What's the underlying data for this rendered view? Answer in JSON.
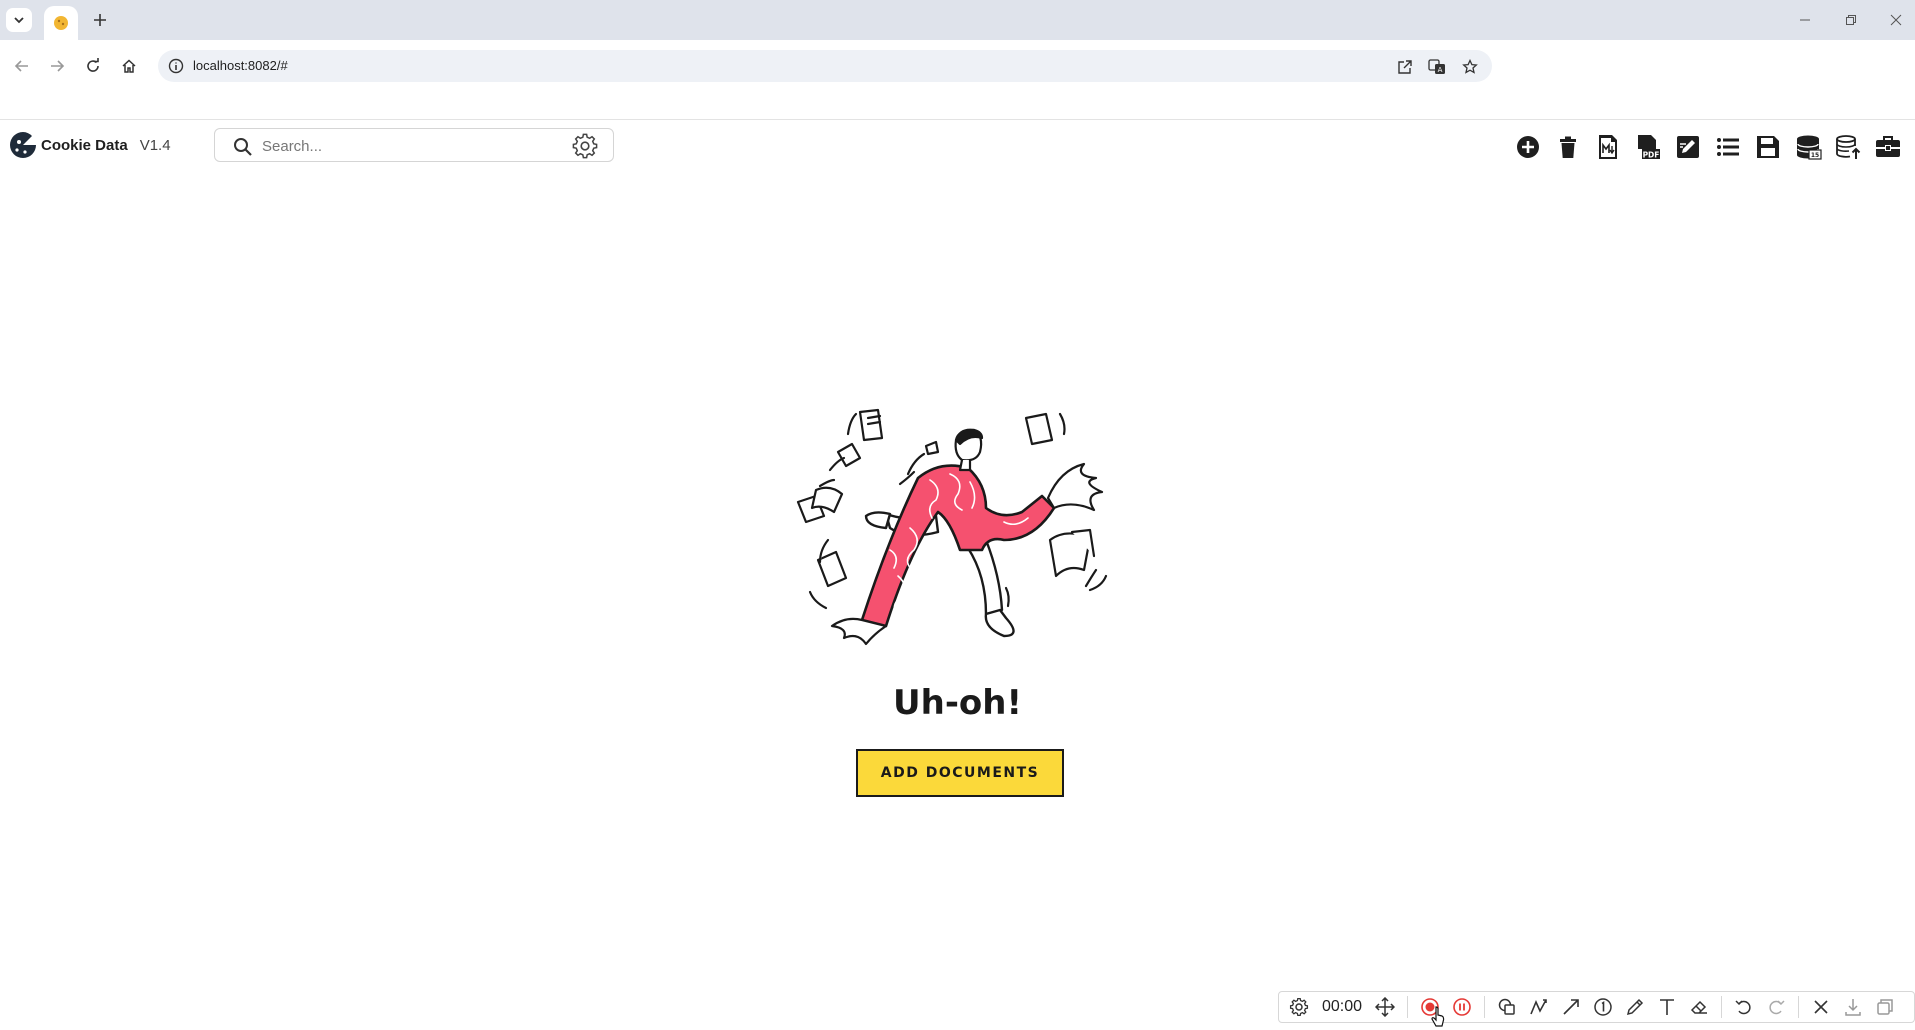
{
  "browser": {
    "url": "localhost:8082/#"
  },
  "app": {
    "brand_name": "Cookie Data",
    "version": "V1.4",
    "search_placeholder": "Search..."
  },
  "toolbar_actions": [
    {
      "name": "add-icon"
    },
    {
      "name": "trash-icon"
    },
    {
      "name": "markdown-file-icon"
    },
    {
      "name": "pdf-file-icon"
    },
    {
      "name": "edit-document-icon"
    },
    {
      "name": "list-icon"
    },
    {
      "name": "save-icon"
    },
    {
      "name": "database-sql-icon"
    },
    {
      "name": "database-upload-icon"
    },
    {
      "name": "toolbox-icon"
    }
  ],
  "empty_state": {
    "title": "Uh-oh!",
    "button_label": "ADD DOCUMENTS"
  },
  "recorder": {
    "time": "00:00"
  },
  "colors": {
    "accent_yellow": "#fbd93a",
    "illustration_pink": "#f5516f",
    "record_red": "#e53935"
  }
}
